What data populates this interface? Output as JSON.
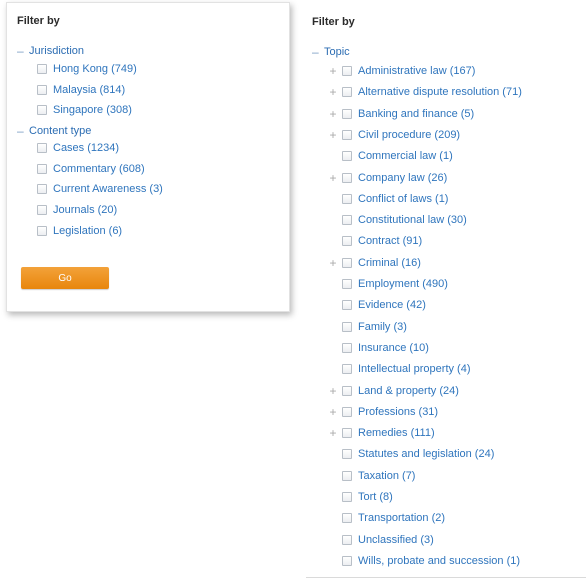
{
  "left_filter": {
    "title": "Filter by",
    "groups": [
      {
        "label": "Jurisdiction",
        "toggle": "–",
        "items": [
          "Hong Kong (749)",
          "Malaysia (814)",
          "Singapore (308)"
        ]
      },
      {
        "label": "Content type",
        "toggle": "–",
        "items": [
          "Cases (1234)",
          "Commentary (608)",
          "Current Awareness (3)",
          "Journals (20)",
          "Legislation (6)"
        ]
      }
    ],
    "go_label": "Go"
  },
  "right_filter": {
    "title": "Filter by",
    "group": {
      "label": "Topic",
      "toggle": "–"
    },
    "items": [
      {
        "label": "Administrative law (167)",
        "expander": "+"
      },
      {
        "label": "Alternative dispute resolution (71)",
        "expander": "+"
      },
      {
        "label": "Banking and finance (5)",
        "expander": "+"
      },
      {
        "label": "Civil procedure (209)",
        "expander": "+"
      },
      {
        "label": "Commercial law (1)",
        "expander": ""
      },
      {
        "label": "Company law (26)",
        "expander": "+"
      },
      {
        "label": "Conflict of laws (1)",
        "expander": ""
      },
      {
        "label": "Constitutional law (30)",
        "expander": ""
      },
      {
        "label": "Contract (91)",
        "expander": ""
      },
      {
        "label": "Criminal (16)",
        "expander": "+"
      },
      {
        "label": "Employment (490)",
        "expander": ""
      },
      {
        "label": "Evidence (42)",
        "expander": ""
      },
      {
        "label": "Family (3)",
        "expander": ""
      },
      {
        "label": "Insurance (10)",
        "expander": ""
      },
      {
        "label": "Intellectual property (4)",
        "expander": ""
      },
      {
        "label": "Land & property (24)",
        "expander": "+"
      },
      {
        "label": "Professions (31)",
        "expander": "+"
      },
      {
        "label": "Remedies (111)",
        "expander": "+"
      },
      {
        "label": "Statutes and legislation (24)",
        "expander": ""
      },
      {
        "label": "Taxation (7)",
        "expander": ""
      },
      {
        "label": "Tort (8)",
        "expander": ""
      },
      {
        "label": "Transportation (2)",
        "expander": ""
      },
      {
        "label": "Unclassified (3)",
        "expander": ""
      },
      {
        "label": "Wills, probate and succession (1)",
        "expander": ""
      }
    ]
  },
  "colors": {
    "link": "#2f75bd",
    "group": "#2c6db3",
    "button": "#e8860c",
    "expander": "#a9a9a9"
  }
}
